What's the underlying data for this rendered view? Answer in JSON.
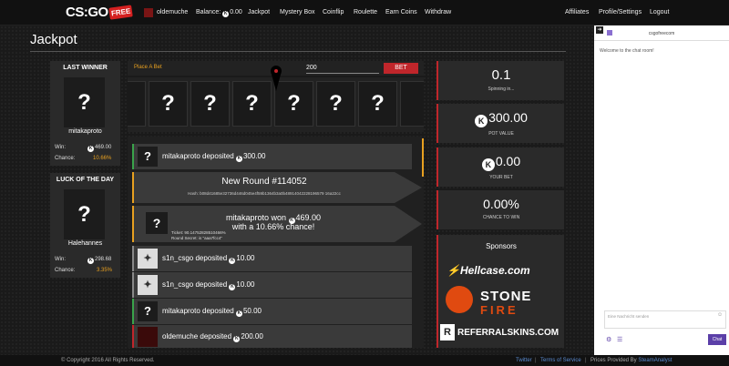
{
  "nav": {
    "logo": "CS:GO",
    "logo_badge": "FREE",
    "username": "oldemuche",
    "balance_label": "Balance:",
    "balance_value": "0.00",
    "links": [
      "Jackpot",
      "Mystery Box",
      "Coinflip",
      "Roulette",
      "Earn Coins",
      "Withdraw"
    ],
    "right_links": [
      "Affiliates",
      "Profile/Settings",
      "Logout"
    ]
  },
  "page": {
    "title": "Jackpot"
  },
  "last_winner": {
    "header": "LAST WINNER",
    "name": "mitakaproto",
    "win_label": "Win:",
    "win_value": "469.00",
    "chance_label": "Chance:",
    "chance_value": "10.66%"
  },
  "luck": {
    "header": "LUCK OF THE DAY",
    "name": "Halehannes",
    "win_label": "Win:",
    "win_value": "298.68",
    "chance_label": "Chance:",
    "chance_value": "3.35%"
  },
  "bet": {
    "label": "Place A Bet",
    "value": "200",
    "button": "BET"
  },
  "reel": {
    "symbol": "?"
  },
  "feed": [
    {
      "user": "mitakaproto",
      "text": "deposited",
      "amount": "300.00"
    },
    {
      "new_round": "New Round #114052",
      "hash": "Hash: b08d41685e32736d446d045e4f59b1364b3a0b48914042228196579 16a22cc"
    },
    {
      "winner": "mitakaproto",
      "won": "won",
      "amount": "469.00",
      "chance_line": "with a 10.66% chance!",
      "ticket": "Ticket: 90.14752828510466%",
      "secret": "Round Secret: is \"aaa7fcc4\""
    },
    {
      "user": "s1n_csgo",
      "text": "deposited",
      "amount": "10.00"
    },
    {
      "user": "s1n_csgo",
      "text": "deposited",
      "amount": "10.00"
    },
    {
      "user": "mitakaproto",
      "text": "deposited",
      "amount": "50.00"
    },
    {
      "user": "oldemuche",
      "text": "deposited",
      "amount": "200.00"
    }
  ],
  "stats": {
    "timer": "0.1",
    "timer_label": "Spinning in...",
    "pot": "300.00",
    "pot_label": "POT VALUE",
    "yourbet": "0.00",
    "yourbet_label": "YOUR BET",
    "chance": "0.00%",
    "chance_label": "CHANCE TO WIN"
  },
  "sponsors": {
    "title": "Sponsors",
    "items": [
      "Hellcase.com",
      "STONE",
      "FIRE",
      "REFERRALSKINS.COM"
    ]
  },
  "chat": {
    "site": "csgofreecom",
    "welcome": "Welcome to the chat room!",
    "placeholder": "Eine Nachricht senden",
    "send": "Chat"
  },
  "footer": {
    "copyright": "© Copyright 2016 All Rights Reserved.",
    "links": [
      "Twitter",
      "Terms of Service",
      "Prices Provided By"
    ],
    "steam": "SteamAnalyst"
  },
  "colors": {
    "accent_red": "#c0262b",
    "gold": "#e8a020",
    "chat_button": "#5b3fa8"
  }
}
